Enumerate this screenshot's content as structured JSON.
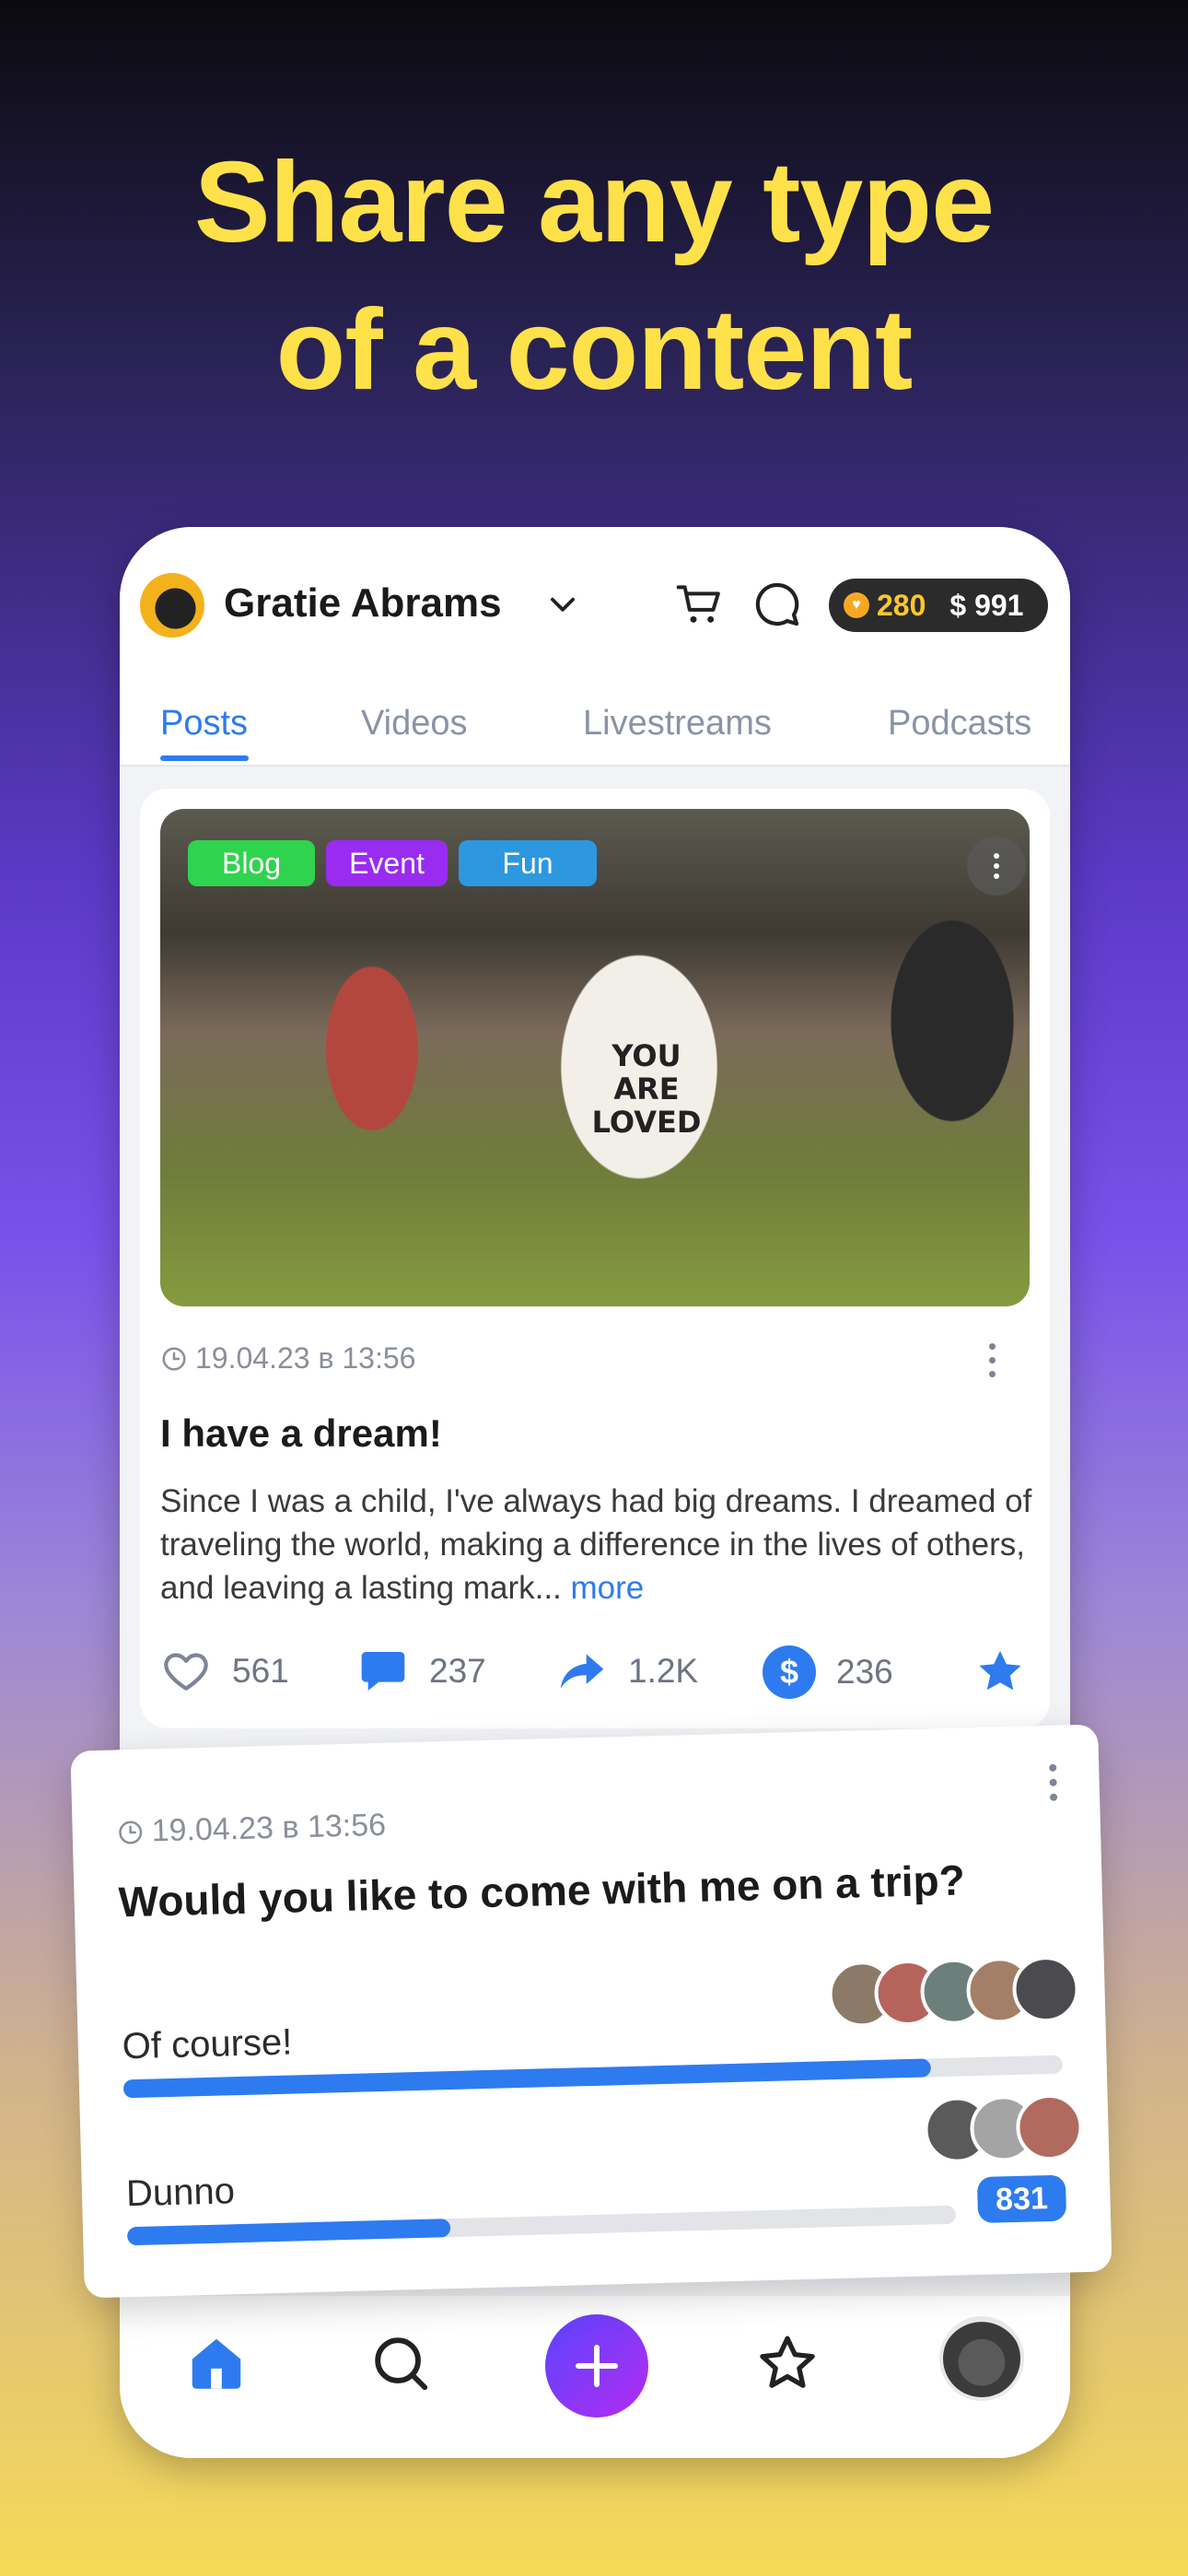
{
  "headline": {
    "line1": "Share any type",
    "line2": "of a content"
  },
  "header": {
    "username": "Gratie Abrams",
    "coins": "280",
    "balance": "$ 991"
  },
  "tabs": [
    {
      "label": "Posts",
      "active": true
    },
    {
      "label": "Videos",
      "active": false
    },
    {
      "label": "Livestreams",
      "active": false
    },
    {
      "label": "Podcasts",
      "active": false
    }
  ],
  "post": {
    "tags": [
      "Blog",
      "Event",
      "Fun"
    ],
    "image_text": "YOU ARE LOVED",
    "datetime": "19.04.23 в 13:56",
    "title": "I have a dream!",
    "body": "Since I was a child, I've always had big dreams. I dreamed of traveling the world, making a difference in the lives of others, and leaving a lasting mark...",
    "more_label": "more",
    "likes": "561",
    "comments": "237",
    "shares": "1.2K",
    "tips": "236"
  },
  "poll": {
    "datetime": "19.04.23 в 13:56",
    "question": "Would you like to come with me on a trip?",
    "options": [
      {
        "label": "Of course!",
        "fraction": 0.86
      },
      {
        "label": "Dunno",
        "fraction": 0.39,
        "count": "831"
      }
    ]
  },
  "icons": [
    "user-avatar",
    "chevron-down-icon",
    "cart-icon",
    "chat-icon",
    "coin-icon",
    "clock-icon",
    "more-dots-icon",
    "heart-icon",
    "comment-icon",
    "share-icon",
    "dollar-icon",
    "star-icon",
    "home-icon",
    "search-icon",
    "plus-icon",
    "profile-avatar"
  ],
  "colors": {
    "accent": "#2e7bf0",
    "headline": "#ffe14a",
    "tag_blog": "#2fd34d",
    "tag_event": "#9a2bf1",
    "tag_fun": "#2d98e0"
  }
}
